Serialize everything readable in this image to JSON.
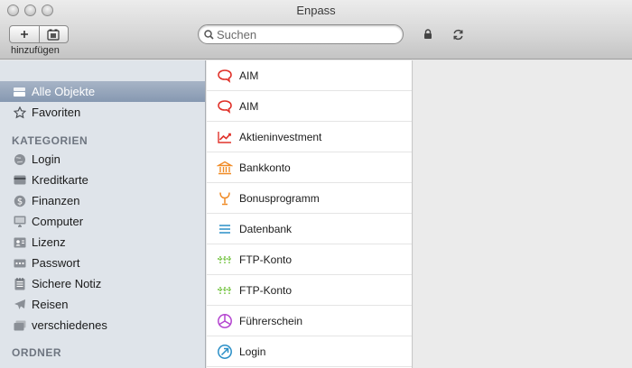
{
  "window": {
    "title": "Enpass"
  },
  "toolbar": {
    "add_caption": "hinzufügen",
    "search_placeholder": "Suchen"
  },
  "sidebar": {
    "items": [
      {
        "label": "Alle Objekte",
        "icon": "stack-icon",
        "selected": true
      },
      {
        "label": "Favoriten",
        "icon": "star-icon"
      }
    ],
    "categories_heading": "KATEGORIEN",
    "categories": [
      {
        "label": "Login",
        "icon": "globe-icon"
      },
      {
        "label": "Kreditkarte",
        "icon": "credit-card-icon"
      },
      {
        "label": "Finanzen",
        "icon": "dollar-icon"
      },
      {
        "label": "Computer",
        "icon": "monitor-icon"
      },
      {
        "label": "Lizenz",
        "icon": "license-icon"
      },
      {
        "label": "Passwort",
        "icon": "password-icon"
      },
      {
        "label": "Sichere Notiz",
        "icon": "note-icon"
      },
      {
        "label": "Reisen",
        "icon": "airplane-icon"
      },
      {
        "label": "verschiedenes",
        "icon": "misc-icon"
      }
    ],
    "folders_heading": "ORDNER"
  },
  "list": {
    "items": [
      {
        "label": "AIM",
        "icon": "chat-bubble-icon",
        "color": "#e0322a"
      },
      {
        "label": "AIM",
        "icon": "chat-bubble-icon",
        "color": "#e0322a"
      },
      {
        "label": "Aktieninvestment",
        "icon": "chart-up-icon",
        "color": "#e0322a"
      },
      {
        "label": "Bankkonto",
        "icon": "bank-icon",
        "color": "#f08a24"
      },
      {
        "label": "Bonusprogramm",
        "icon": "goblet-icon",
        "color": "#f08a24"
      },
      {
        "label": "Datenbank",
        "icon": "lines-icon",
        "color": "#2a8fc7"
      },
      {
        "label": "FTP-Konto",
        "icon": "network-icon",
        "color": "#6fc13a"
      },
      {
        "label": "FTP-Konto",
        "icon": "network-icon",
        "color": "#6fc13a"
      },
      {
        "label": "Führerschein",
        "icon": "cube-icon",
        "color": "#b445d0"
      },
      {
        "label": "Login",
        "icon": "arrow-circle-icon",
        "color": "#2a8fc7"
      }
    ]
  }
}
